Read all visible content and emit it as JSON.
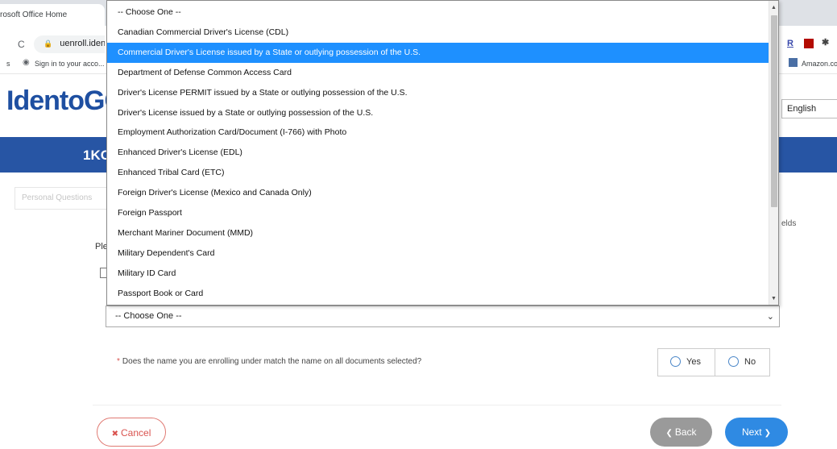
{
  "browser": {
    "tab_title": "rosoft Office Home",
    "url": "uenroll.ident",
    "bookmark_1": "s",
    "bookmark_2": "Sign in to your acco...",
    "bookmark_right": "Amazon.co",
    "ext_r": "R"
  },
  "page": {
    "logo_text": "IdentoGO",
    "language": "English",
    "banner_title": "1KC",
    "step_tab": "Personal Questions",
    "fields_text": "elds",
    "please_text": "Ple"
  },
  "document_select": {
    "value": "-- Choose One --"
  },
  "dropdown": {
    "items": [
      "-- Choose One --",
      "Canadian Commercial Driver's License (CDL)",
      "Commercial Driver's License issued by a State or outlying possession of the U.S.",
      "Department of Defense Common Access Card",
      "Driver's License PERMIT issued by a State or outlying possession of the U.S.",
      "Driver's License issued by a State or outlying possession of the U.S.",
      "Employment Authorization Card/Document (I-766) with Photo",
      "Enhanced Driver's License (EDL)",
      "Enhanced Tribal Card (ETC)",
      "Foreign Driver's License (Mexico and Canada Only)",
      "Foreign Passport",
      "Merchant Mariner Document (MMD)",
      "Military Dependent's Card",
      "Military ID Card",
      "Passport Book or Card"
    ],
    "selected_index": 2
  },
  "question": {
    "required_mark": "*",
    "text": "Does the name you are enrolling under match the name on all documents selected?",
    "yes_label": "Yes",
    "no_label": "No"
  },
  "buttons": {
    "cancel_icon": "✖",
    "cancel": "Cancel",
    "back_icon": "❮",
    "back": "Back",
    "next": "Next",
    "next_icon": "❯"
  },
  "colors": {
    "brand_blue": "#2755a4",
    "selection_blue": "#1e90ff",
    "next_blue": "#2f8ae3",
    "cancel_red": "#d9534f"
  }
}
